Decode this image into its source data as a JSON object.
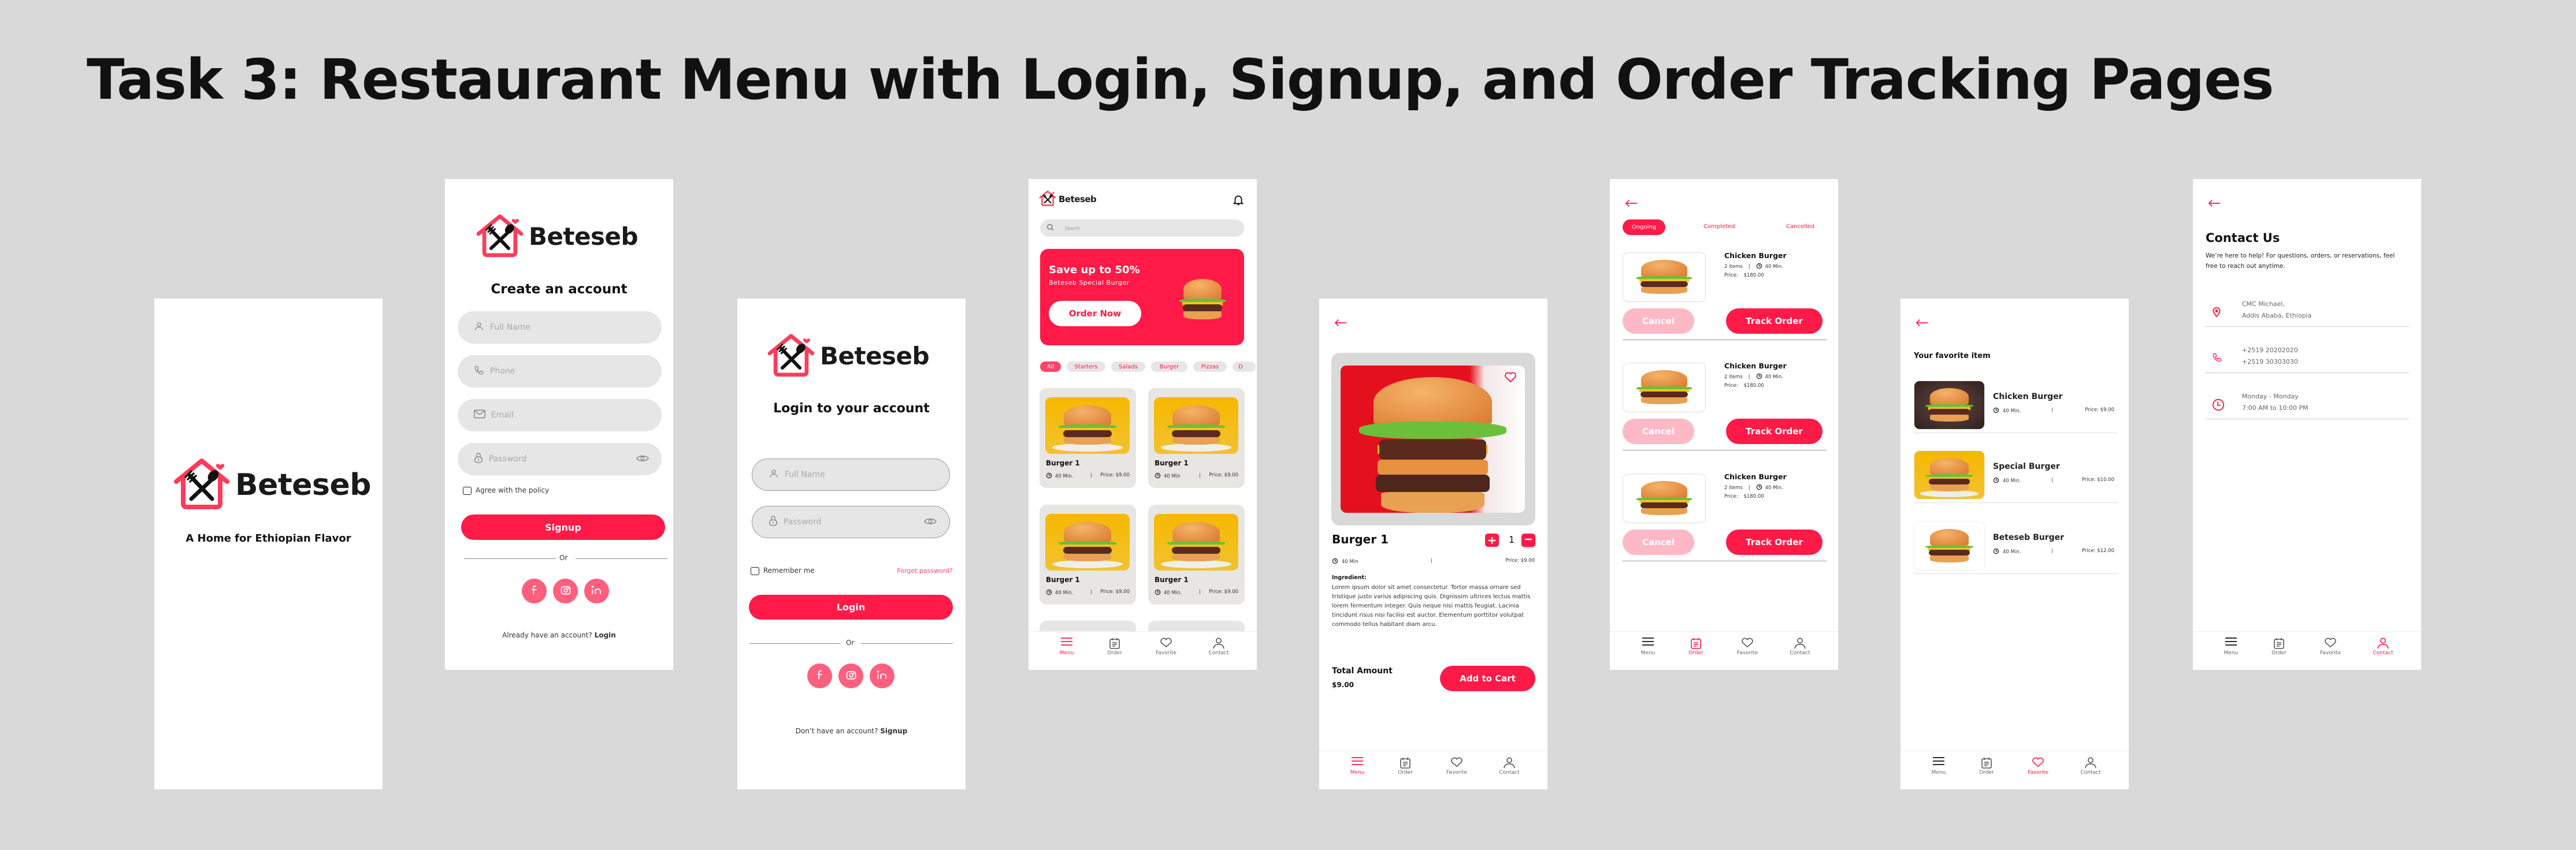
{
  "page": {
    "title": "Task 3: Restaurant Menu with Login, Signup, and Order Tracking Pages"
  },
  "brand": {
    "name": "Beteseb",
    "accent": "#ff1a47",
    "accent_light": "#ffb8c6",
    "social_bg": "#ff5f7e"
  },
  "splash": {
    "tagline": "A Home for Ethiopian Flavor"
  },
  "signup": {
    "heading": "Create an account",
    "fields": {
      "full_name": "Full Name",
      "phone": "Phone",
      "email": "Email",
      "password": "Password"
    },
    "agree_label": "Agree with the policy",
    "submit": "Signup",
    "or": "Or",
    "footer_text": "Already have an account?",
    "footer_link": "Login"
  },
  "login": {
    "heading": "Login to your account",
    "fields": {
      "full_name": "Full Name",
      "password": "Password"
    },
    "remember": "Remember me",
    "forgot": "Forget password?",
    "submit": "Login",
    "or": "Or",
    "footer_text": "Don’t have an account?",
    "footer_link": "Signup"
  },
  "menu": {
    "search_placeholder": "Search",
    "banner": {
      "title": "Save up to 50%",
      "subtitle": "Beteseb Special Burger",
      "cta": "Order Now"
    },
    "categories": [
      {
        "label": "All",
        "active": true
      },
      {
        "label": "Starters"
      },
      {
        "label": "Salads"
      },
      {
        "label": "Burger"
      },
      {
        "label": "Pizzas"
      },
      {
        "label": "D"
      }
    ],
    "items": [
      {
        "name": "Burger 1",
        "time": "40 Min.",
        "price": "Price: $9.00"
      },
      {
        "name": "Burger 1",
        "time": "40 Min",
        "price": "Price: $9.00"
      },
      {
        "name": "Burger 1",
        "time": "40 Min.",
        "price": "Price: $9.00"
      },
      {
        "name": "Burger 1",
        "time": "40 Min.",
        "price": "Price: $9.00"
      }
    ]
  },
  "detail": {
    "name": "Burger 1",
    "quantity": "1",
    "time": "40 Min",
    "separator": "|",
    "price": "Price: $9.00",
    "ingredient_label": "Ingredient:",
    "ingredients": "Lorem ipsum dolor sit amet consectetur. Tortor massa ornare sed tristique justo varius adipiscing quis. Dignissim ultrices lectus mattis lorem fermentum integer. Quis neque nisi mattis feugiat. Lacinia tincidunt risus nisi facilisi est auctor. Elementum porttitor volutpat commodo tellus habitant diam arcu.",
    "total_label": "Total Amount",
    "total_value": "$9.00",
    "add_to_cart": "Add to Cart"
  },
  "orders": {
    "tabs": [
      {
        "label": "Ongoing",
        "active": true
      },
      {
        "label": "Completed"
      },
      {
        "label": "Cancelled"
      }
    ],
    "items": [
      {
        "name": "Chicken Burger",
        "count": "2 items",
        "time": "40 Min.",
        "price_label": "Price:",
        "price": "$180.00",
        "cancel": "Cancel",
        "track": "Track Order"
      },
      {
        "name": "Chicken Burger",
        "count": "2 items",
        "time": "40 Min.",
        "price_label": "Price:",
        "price": "$180.00",
        "cancel": "Cancel",
        "track": "Track Order"
      },
      {
        "name": "Chicken Burger",
        "count": "2 items",
        "time": "40 Min.",
        "price_label": "Price:",
        "price": "$180.00",
        "cancel": "Cancel",
        "track": "Track Order"
      }
    ]
  },
  "favorites": {
    "heading": "Your favorite item",
    "items": [
      {
        "name": "Chicken Burger",
        "time": "40 Min.",
        "price": "Price: $9.00"
      },
      {
        "name": "Special Burger",
        "time": "40 Min.",
        "price": "Price: $10.00"
      },
      {
        "name": "Beteseb Burger",
        "time": "40 Min.",
        "price": "Price: $12.00"
      }
    ]
  },
  "contact": {
    "heading": "Contact Us",
    "description": "We’re here to help! For questions, orders, or reservations, feel free to reach out anytime.",
    "rows": [
      {
        "icon": "location-pin-icon",
        "line1": "CMC Michael,",
        "line2": "Addis Ababa, Ethiopia"
      },
      {
        "icon": "phone-icon",
        "line1": "+2519 20202020",
        "line2": "+2519 30303030"
      },
      {
        "icon": "clock-icon",
        "line1": "Monday - Monday",
        "line2": "7:00 AM to 10:00 PM"
      }
    ]
  },
  "nav": {
    "items": [
      {
        "label": "Menu",
        "icon": "menu-icon"
      },
      {
        "label": "Order",
        "icon": "order-icon"
      },
      {
        "label": "Favorite",
        "icon": "heart-icon"
      },
      {
        "label": "Contact",
        "icon": "person-icon"
      }
    ]
  }
}
